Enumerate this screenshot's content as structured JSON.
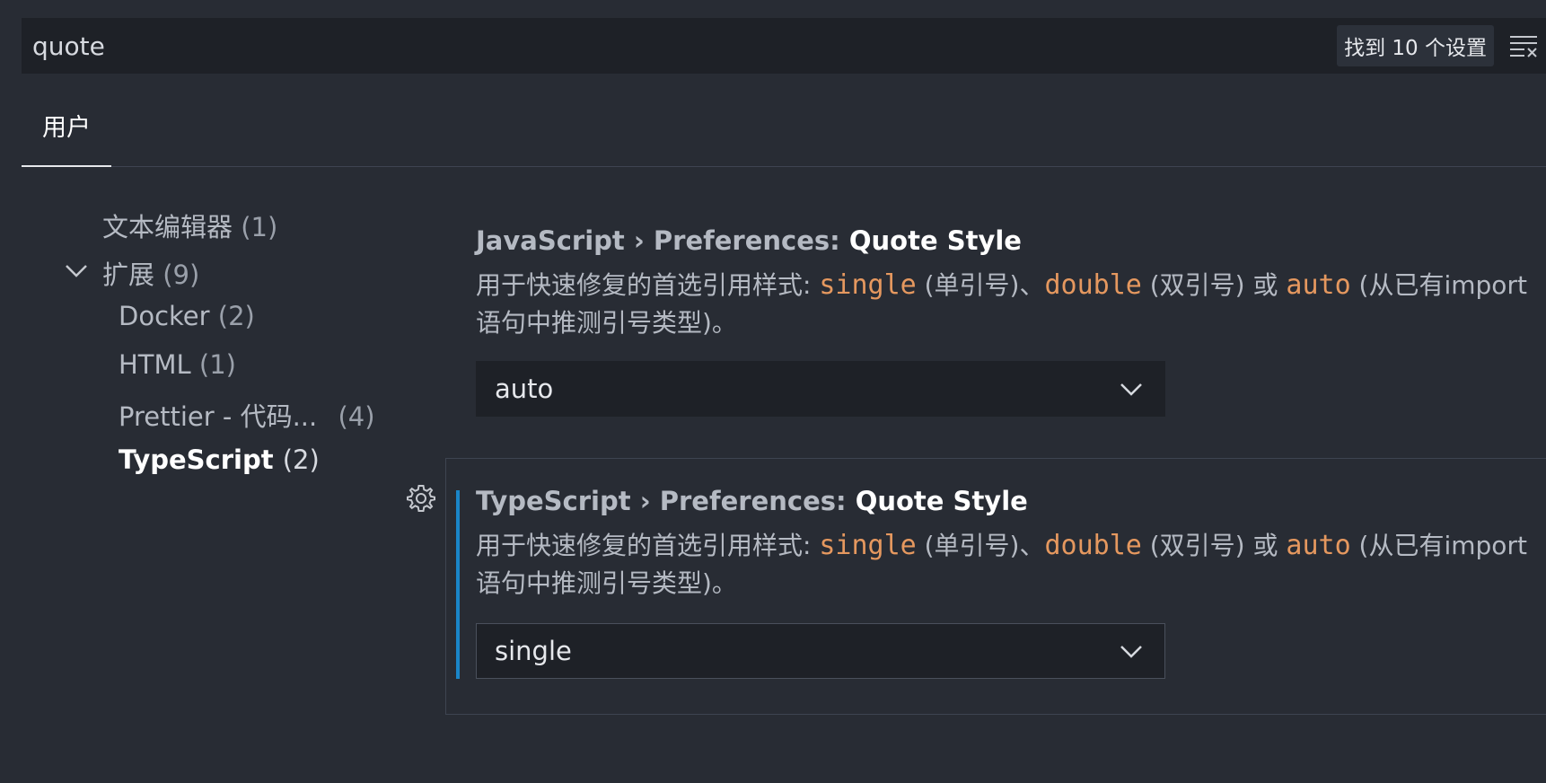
{
  "search": {
    "value": "quote",
    "result_count": "找到 10 个设置"
  },
  "tabs": [
    {
      "label": "用户"
    }
  ],
  "toc": {
    "items": [
      {
        "label": "文本编辑器",
        "count": "(1)"
      },
      {
        "label": "扩展",
        "count": "(9)"
      },
      {
        "label": "Docker",
        "count": "(2)"
      },
      {
        "label": "HTML",
        "count": "(1)"
      },
      {
        "label": "Prettier - 代码...",
        "count": "(4)"
      },
      {
        "label": "TypeScript",
        "count": "(2)"
      }
    ]
  },
  "settings": [
    {
      "scope": "JavaScript › Preferences: ",
      "key": "Quote Style",
      "desc_prefix": "用于快速修复的首选引用样式: ",
      "opt1": "single",
      "desc_mid1": " (单引号)、",
      "opt2": "double",
      "desc_mid2": " (双引号) 或 ",
      "opt3": "auto",
      "desc_suffix": " (从已有import 语句中推测引号类型)。",
      "value": "auto"
    },
    {
      "scope": "TypeScript › Preferences: ",
      "key": "Quote Style",
      "desc_prefix": "用于快速修复的首选引用样式: ",
      "opt1": "single",
      "desc_mid1": " (单引号)、",
      "opt2": "double",
      "desc_mid2": " (双引号) 或 ",
      "opt3": "auto",
      "desc_suffix": " (从已有import 语句中推测引号类型)。",
      "value": "single"
    }
  ],
  "icons": {
    "filter": "filter-list-icon",
    "gear": "gear-icon",
    "chevron": "chevron-down-icon"
  },
  "colors": {
    "accent": "#1a85c8",
    "code": "#e5985f",
    "background": "#282c34"
  }
}
